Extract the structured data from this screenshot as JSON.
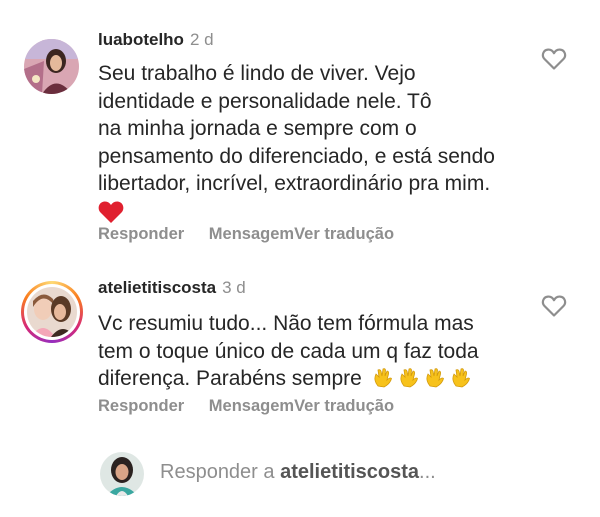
{
  "comments": [
    {
      "username": "luabotelho",
      "time": "2 d",
      "lines": [
        "Seu trabalho é lindo de viver. Vejo",
        "identidade e personalidade nele. Tô",
        "na minha jornada e sempre com o",
        "pensamento do diferenciado, e está sendo",
        "libertador, incrível, extraordinário pra mim."
      ],
      "trailing_emoji": "red-heart",
      "actions": {
        "reply": "Responder",
        "message": "Mensagem",
        "translate": "Ver tradução"
      },
      "like_icon": "heart-outline-icon"
    },
    {
      "username": "atelietitiscosta",
      "time": "3 d",
      "lines": [
        "Vc resumiu tudo... Não tem fórmula mas",
        "tem o toque único de cada um q faz toda",
        "diferença. Parabéns sempre"
      ],
      "trailing_emoji": "clapping-hands x4",
      "actions": {
        "reply": "Responder",
        "message": "Mensagem",
        "translate": "Ver tradução"
      },
      "like_icon": "heart-outline-icon"
    }
  ],
  "reply_bar": {
    "prefix": "Responder a ",
    "target": "atelietitiscosta",
    "ellipsis": "..."
  },
  "colors": {
    "text": "#262626",
    "muted": "#8e8e8e",
    "heart": "#e0202f",
    "clap": "#f7c21b"
  }
}
